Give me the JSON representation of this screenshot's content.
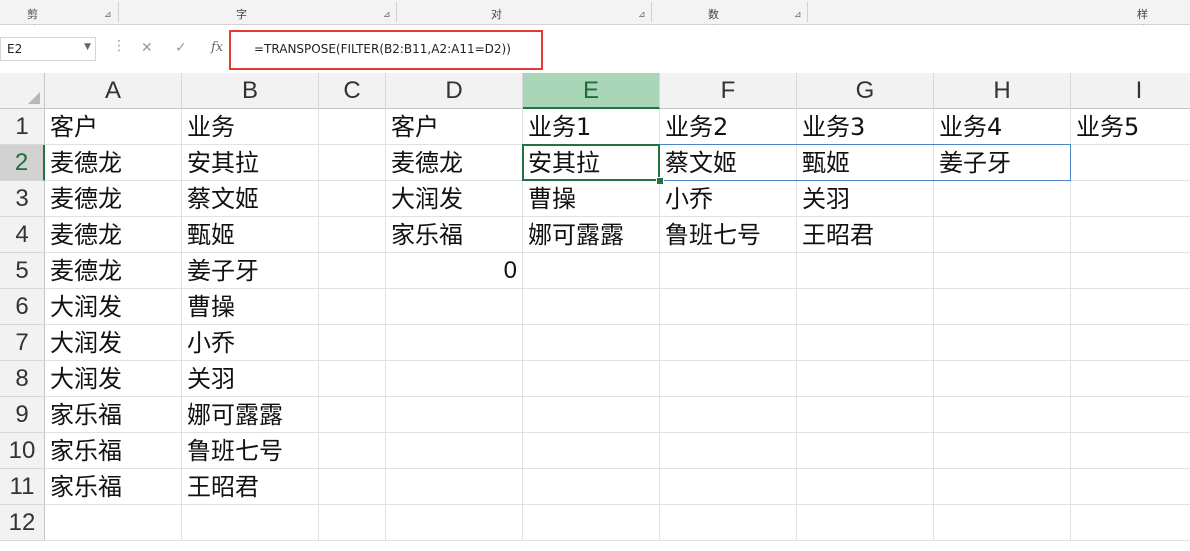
{
  "ribbon": {
    "groups": [
      {
        "label": "剪贴板"
      },
      {
        "label": "字体"
      },
      {
        "label": "对齐方式"
      },
      {
        "label": "数字"
      },
      {
        "label": "样式"
      }
    ]
  },
  "namebox": {
    "value": "E2"
  },
  "formula": {
    "value": "=TRANSPOSE(FILTER(B2:B11,A2:A11=D2))"
  },
  "columns": [
    "A",
    "B",
    "C",
    "D",
    "E",
    "F",
    "G",
    "H",
    "I"
  ],
  "rows": [
    "1",
    "2",
    "3",
    "4",
    "5",
    "6",
    "7",
    "8",
    "9",
    "10",
    "11",
    "12"
  ],
  "cells": {
    "A1": "客户",
    "B1": "业务",
    "A2": "麦德龙",
    "B2": "安其拉",
    "A3": "麦德龙",
    "B3": "蔡文姬",
    "A4": "麦德龙",
    "B4": "甄姬",
    "A5": "麦德龙",
    "B5": "姜子牙",
    "A6": "大润发",
    "B6": "曹操",
    "A7": "大润发",
    "B7": "小乔",
    "A8": "大润发",
    "B8": "关羽",
    "A9": "家乐福",
    "B9": "娜可露露",
    "A10": "家乐福",
    "B10": "鲁班七号",
    "A11": "家乐福",
    "B11": "王昭君",
    "D1": "客户",
    "E1": "业务1",
    "F1": "业务2",
    "G1": "业务3",
    "H1": "业务4",
    "I1": "业务5",
    "D2": "麦德龙",
    "E2": "安其拉",
    "F2": "蔡文姬",
    "G2": "甄姬",
    "H2": "姜子牙",
    "D3": "大润发",
    "E3": "曹操",
    "F3": "小乔",
    "G3": "关羽",
    "D4": "家乐福",
    "E4": "娜可露露",
    "F4": "鲁班七号",
    "G4": "王昭君",
    "D5": "0"
  },
  "selection": {
    "active_cell": "E2",
    "active_column": "E",
    "active_row": "2"
  }
}
